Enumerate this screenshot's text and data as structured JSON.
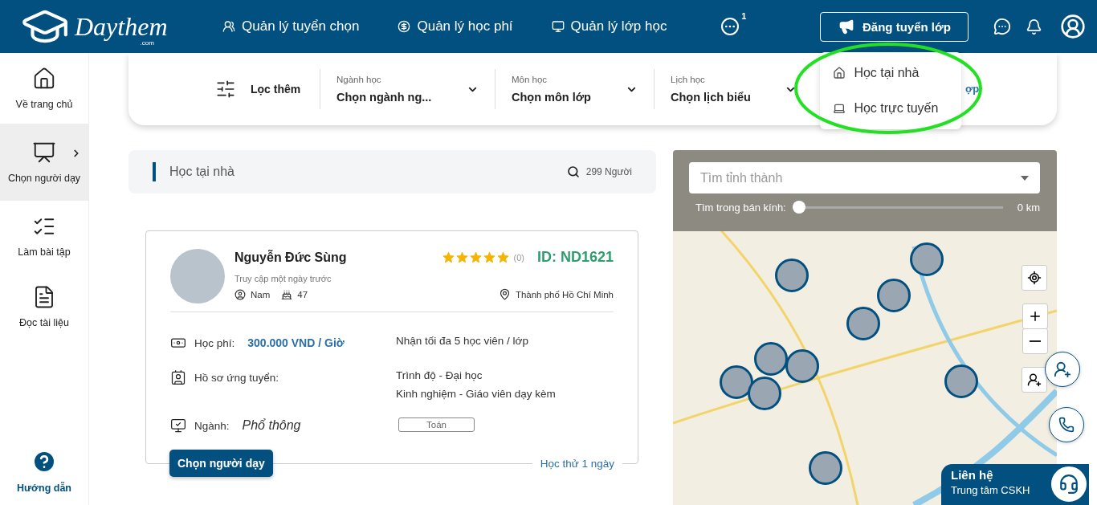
{
  "header": {
    "logo": {
      "name": "Daythem",
      "suffix": ".com"
    },
    "nav": [
      {
        "label": "Quản lý tuyển chọn"
      },
      {
        "label": "Quản lý học phí"
      },
      {
        "label": "Quản lý lớp học"
      }
    ],
    "more_badge": "1",
    "post_button": "Đăng tuyển lớp"
  },
  "post_menu": [
    {
      "label": "Học tại nhà"
    },
    {
      "label": "Học trực tuyến"
    }
  ],
  "sidebar": {
    "items": [
      {
        "label": "Về trang chủ",
        "selected": false
      },
      {
        "label": "Chọn người dạy",
        "selected": true
      },
      {
        "label": "Làm bài tập",
        "selected": false
      },
      {
        "label": "Đọc tài liệu",
        "selected": false
      }
    ],
    "help": "Hướng dẫn"
  },
  "filters": {
    "title": "Lọc thêm",
    "fields": [
      {
        "label": "Ngành học",
        "value": "Chọn ngành ng..."
      },
      {
        "label": "Môn học",
        "value": "Chọn môn lớp"
      },
      {
        "label": "Lịch học",
        "value": "Chọn lịch biểu"
      }
    ],
    "partial_text": "ợp"
  },
  "list_header": {
    "title": "Học tại nhà",
    "count": "299 Người"
  },
  "tutor": {
    "name": "Nguyễn Đức Sùng",
    "last_seen": "Truy cập một ngày trước",
    "gender": "Nam",
    "age": "47",
    "stars": 5,
    "reviews": "(0)",
    "id": "ID: ND1621",
    "location": "Thành phố Hồ Chí Minh",
    "fee_label": "Học phí:",
    "fee": "300.000 VND / Giờ",
    "capacity": "Nhận tối đa 5 học viên / lớp",
    "profile_label": "Hồ sơ ứng tuyển:",
    "profile_lines": [
      "Trình độ - Đại học",
      "Kinh nghiệm - Giáo viên dạy kèm"
    ],
    "field_label": "Ngành:",
    "field_value": "Phổ thông",
    "subjects": [
      "Toán"
    ],
    "choose_button": "Chọn người dạy",
    "trial": "Học thử 1 ngày"
  },
  "map": {
    "search_placeholder": "Tìm tỉnh thành",
    "radius_label": "Tìm trong bán kính:",
    "radius": {
      "level": 0,
      "reading": "0 km"
    }
  },
  "contact": {
    "title": "Liên hệ",
    "subtitle": "Trung tâm CSKH"
  }
}
